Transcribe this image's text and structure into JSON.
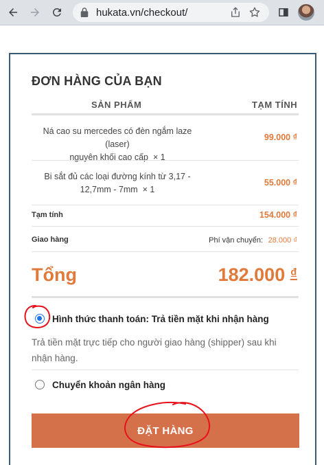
{
  "browser": {
    "url": "hukata.vn/checkout/"
  },
  "checkout": {
    "heading": "ĐƠN HÀNG CỦA BẠN",
    "col_product": "SẢN PHẨM",
    "col_subtotal": "TẠM TÍNH",
    "items": [
      {
        "name_line1": "Ná cao su mercedes có đèn ngắm laze (laser)",
        "name_line2": "nguyên khối cao cấp",
        "qty": "× 1",
        "price": "99.000 ₫"
      },
      {
        "name_line1": "Bi sắt đủ các loại đường kính từ 3,17 -",
        "name_line2": "12,7mm - 7mm",
        "qty": "× 1",
        "price": "55.000 ₫"
      }
    ],
    "subtotal_label": "Tạm tính",
    "subtotal_value": "154.000 ₫",
    "shipping_label": "Giao hàng",
    "shipping_note": "Phí vận chuyển:",
    "shipping_value": "28.000 ₫",
    "total_label": "Tổng",
    "total_amount": "182.000",
    "total_currency": "₫",
    "payment": {
      "cod_label": "Hình thức thanh toán: Trả tiền mặt khi nhận hàng",
      "cod_checked": true,
      "cod_desc": "Trả tiền mặt trực tiếp cho người giao hàng (shipper) sau khi nhận hàng.",
      "bank_label": "Chuyển khoản ngân hàng",
      "bank_checked": false
    },
    "order_button": "ĐẶT HÀNG"
  },
  "colors": {
    "accent": "#e0793a",
    "button": "#d4704a",
    "annotation": "#e8101a"
  }
}
